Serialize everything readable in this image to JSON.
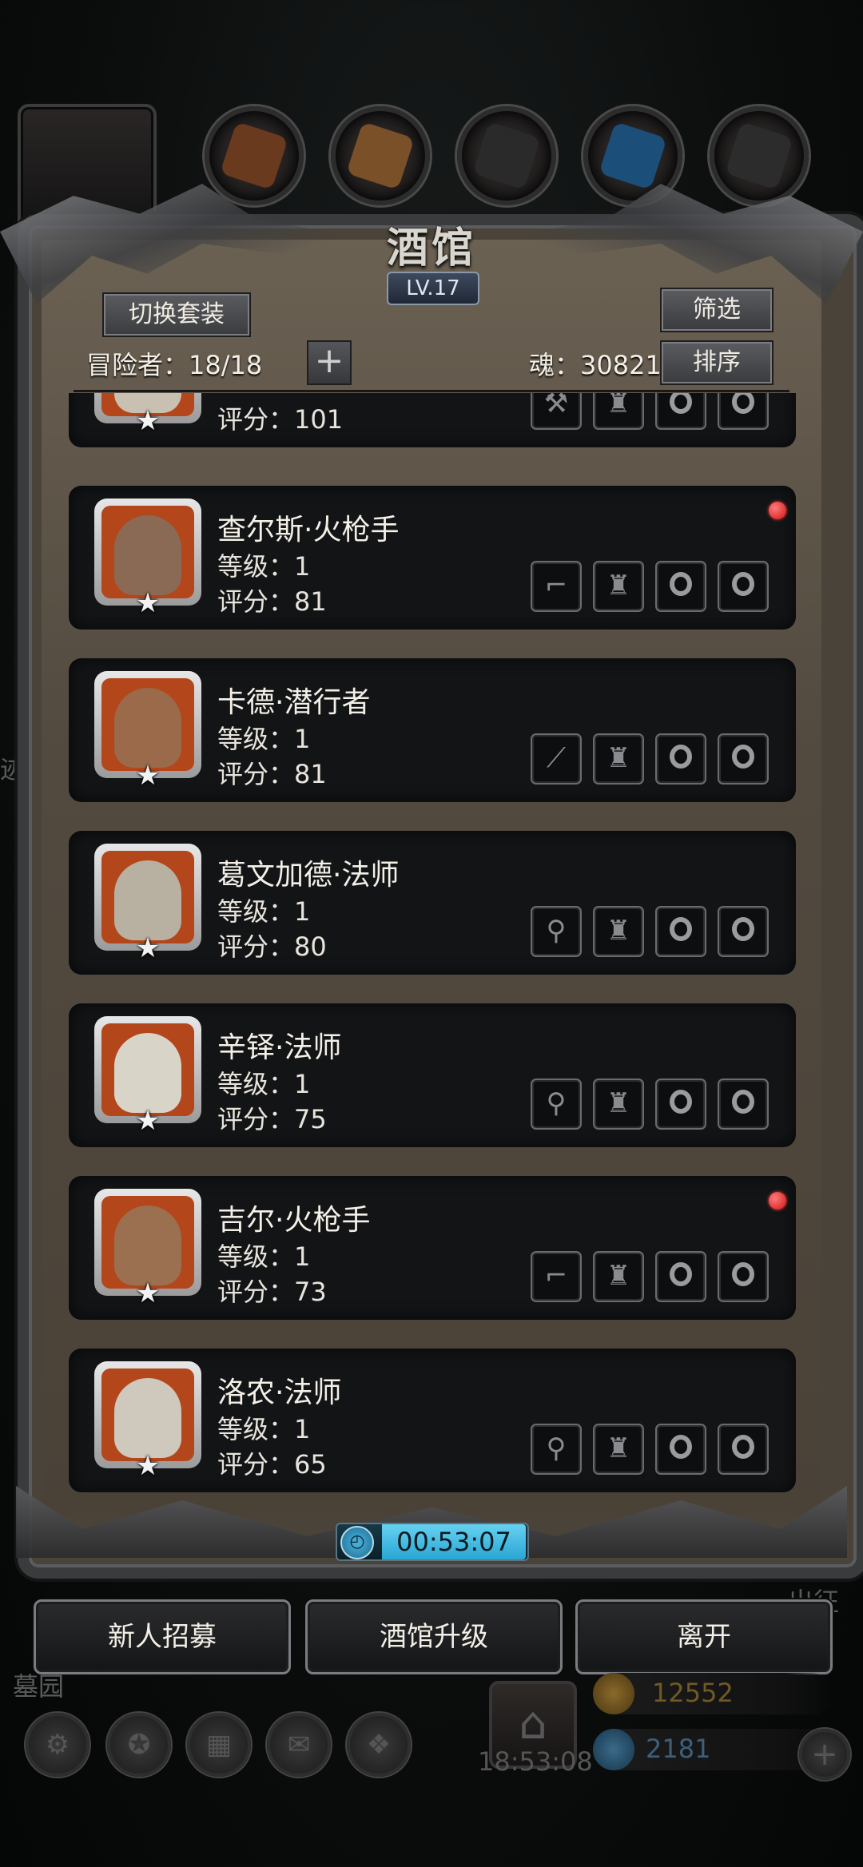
{
  "panel": {
    "title": "酒馆",
    "level": "LV.17",
    "switch_outfit_label": "切换套装",
    "filter_label": "筛选",
    "sort_label": "排序",
    "adventurers_label": "冒险者：18/18",
    "add_symbol": "+",
    "soul_label": "魂：30821"
  },
  "heroes": [
    {
      "name": "",
      "level": "",
      "score": "评分：101",
      "weapon": "axe",
      "new": false
    },
    {
      "name": "查尔斯·火枪手",
      "level": "等级：1",
      "score": "评分：81",
      "weapon": "musket",
      "new": true,
      "portrait_color": "#8a6a55"
    },
    {
      "name": "卡德·潜行者",
      "level": "等级：1",
      "score": "评分：81",
      "weapon": "dagger",
      "new": false,
      "portrait_color": "#9a6a4a"
    },
    {
      "name": "葛文加德·法师",
      "level": "等级：1",
      "score": "评分：80",
      "weapon": "staff",
      "new": false,
      "portrait_color": "#b8b0a0"
    },
    {
      "name": "辛铎·法师",
      "level": "等级：1",
      "score": "评分：75",
      "weapon": "staff",
      "new": false,
      "portrait_color": "#d8d4c8"
    },
    {
      "name": "吉尔·火枪手",
      "level": "等级：1",
      "score": "评分：73",
      "weapon": "musket",
      "new": true,
      "portrait_color": "#9a7050"
    },
    {
      "name": "洛农·法师",
      "level": "等级：1",
      "score": "评分：65",
      "weapon": "staff",
      "new": false,
      "portrait_color": "#cfc8bc"
    }
  ],
  "timer": "00:53:07",
  "actions": {
    "recruit": "新人招募",
    "upgrade": "酒馆升级",
    "leave": "离开"
  },
  "background": {
    "expedition": "出征",
    "graveyard": "墓园",
    "clock": "18:53:08",
    "gold": "12552",
    "gems": "2181",
    "trace": "迹"
  },
  "colors": {
    "card_bg": "#121416",
    "portrait_frame": "#b4461b",
    "new_dot": "#d31212",
    "timer_accent": "#2aa6d3"
  }
}
